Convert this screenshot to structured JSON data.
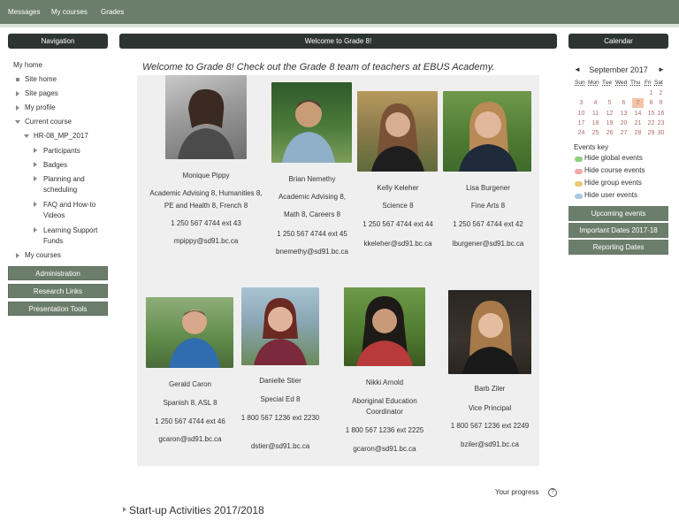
{
  "topnav": {
    "messages": "Messages",
    "courses": "My courses",
    "grades": "Grades"
  },
  "navigation": {
    "title": "Navigation",
    "my_home": "My home",
    "site_home": "Site home",
    "site_pages": "Site pages",
    "my_profile": "My profile",
    "current_course": "Current course",
    "course_code": "HR-08_MP_2017",
    "items": [
      "Participants",
      "Badges",
      "Planning and scheduling",
      "FAQ and How-to Videos",
      "Learning Support Funds"
    ],
    "my_courses": "My courses"
  },
  "left_buttons": [
    "Administration",
    "Research Links",
    "Presentation Tools"
  ],
  "main": {
    "header": "Welcome to Grade 8!",
    "welcome": "Welcome to Grade 8!  Check out the Grade 8 team of teachers at EBUS Academy."
  },
  "teachers": [
    {
      "name": "Monique Pippy",
      "role": "Academic Advising 8, Humanities 8,",
      "role2": "PE and Health 8, French 8",
      "phone": "1 250 567 4744 ext 43",
      "email": "mpippy@sd91.bc.ca"
    },
    {
      "name": "Brian Nemethy",
      "role": "Academic Advising 8,",
      "role2": "Math 8, Careers 8",
      "phone": "1 250 567 4744 ext 45",
      "email": "bnemethy@sd91.bc.ca"
    },
    {
      "name": "Kelly Keleher",
      "role": "Science 8",
      "phone": "1 250 567 4744 ext 44",
      "email": "kkeleher@sd91.bc.ca"
    },
    {
      "name": "Lisa Burgener",
      "role": "Fine Arts 8",
      "phone": "1 250 567 4744 ext 42",
      "email": "lburgener@sd91.bc.ca"
    },
    {
      "name": "Gerald Caron",
      "role": "Spanish 8, ASL 8",
      "phone": "1 250 567 4744 ext 46",
      "email": "gcaron@sd91.bc.ca"
    },
    {
      "name": "Danielle Stier",
      "role": "Special Ed 8",
      "phone": "1 800 567 1236 ext 2230",
      "email": "dstier@sd91.bc.ca"
    },
    {
      "name": "Nikki Arnold",
      "role": "Aboriginal Education Coordinator",
      "phone": "1 800 567 1236 ext 2225",
      "email": "gcaron@sd91.bc.ca"
    },
    {
      "name": "Barb Ziler",
      "role": "Vice Principal",
      "phone": "1 800 567 1236 ext 2249",
      "email": "bziler@sd91.bc.ca"
    }
  ],
  "calendar": {
    "title": "Calendar",
    "month": "September 2017",
    "prev": "◄",
    "next": "►",
    "days": [
      "Sun",
      "Mon",
      "Tue",
      "Wed",
      "Thu",
      "Fri",
      "Sat"
    ],
    "dates": [
      "1",
      "2",
      "3",
      "4",
      "5",
      "6",
      "7",
      "8",
      "9",
      "10",
      "11",
      "12",
      "13",
      "14",
      "15",
      "16",
      "17",
      "18",
      "19",
      "20",
      "21",
      "22",
      "23",
      "24",
      "25",
      "26",
      "27",
      "28",
      "29",
      "30"
    ],
    "today": "7",
    "events_key": "Events key",
    "hide": [
      "Hide global events",
      "Hide course events",
      "Hide group events",
      "Hide user events"
    ]
  },
  "right_buttons": [
    "Upcoming events",
    "Important Dates 2017-18",
    "Reporting Dates"
  ],
  "footer": {
    "progress": "Your progress",
    "help": "?",
    "section": "Start-up Activities 2017/2018"
  },
  "colors": {
    "green": "#6b7d6b",
    "dark": "#2d3431",
    "today": "#f3c4a8"
  }
}
